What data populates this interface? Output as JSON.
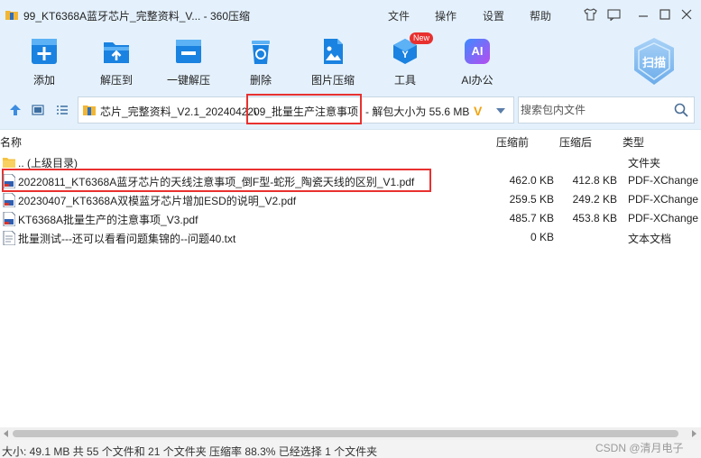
{
  "window": {
    "title": "99_KT6368A蓝牙芯片_完整资料_V... - 360压缩",
    "menus": [
      "文件",
      "操作",
      "设置",
      "帮助"
    ]
  },
  "toolbar": {
    "add": "添加",
    "extract_to": "解压到",
    "one_click_extract": "一键解压",
    "delete": "删除",
    "image_compress": "图片压缩",
    "tools": "工具",
    "tools_badge": "New",
    "ai_office": "AI办公",
    "ai_icon_text": "AI",
    "scan": "扫描"
  },
  "address": {
    "path_prefix": "芯片_完整资料_V2.1_20240422\\",
    "path_highlight": "09_批量生产注意事项",
    "size_text": "- 解包大小为 55.6 MB",
    "v_mark": "V",
    "search_placeholder": "搜索包内文件"
  },
  "list": {
    "columns": {
      "name": "名称",
      "packed": "压缩前",
      "unpacked": "压缩后",
      "type": "类型"
    },
    "rows": [
      {
        "name": ".. (上级目录)",
        "packed": "",
        "unpacked": "",
        "type": "文件夹"
      },
      {
        "name": "20220811_KT6368A蓝牙芯片的天线注意事项_倒F型-蛇形_陶瓷天线的区别_V1.pdf",
        "packed": "462.0 KB",
        "unpacked": "412.8 KB",
        "type": "PDF-XChange"
      },
      {
        "name": "20230407_KT6368A双模蓝牙芯片增加ESD的说明_V2.pdf",
        "packed": "259.5 KB",
        "unpacked": "249.2 KB",
        "type": "PDF-XChange"
      },
      {
        "name": "KT6368A批量生产的注意事项_V3.pdf",
        "packed": "485.7 KB",
        "unpacked": "453.8 KB",
        "type": "PDF-XChange"
      },
      {
        "name": "批量测试---还可以看看问题集锦的--问题40.txt",
        "packed": "0 KB",
        "unpacked": "",
        "type": "文本文档"
      }
    ]
  },
  "status": {
    "text": "大小: 49.1 MB 共 55 个文件和 21 个文件夹 压缩率 88.3% 已经选择 1 个文件夹",
    "watermark": "CSDN @清月电子"
  },
  "colors": {
    "accent": "#1a78d8",
    "highlight": "#e8312f",
    "bar_bg": "#e4f1fd"
  }
}
